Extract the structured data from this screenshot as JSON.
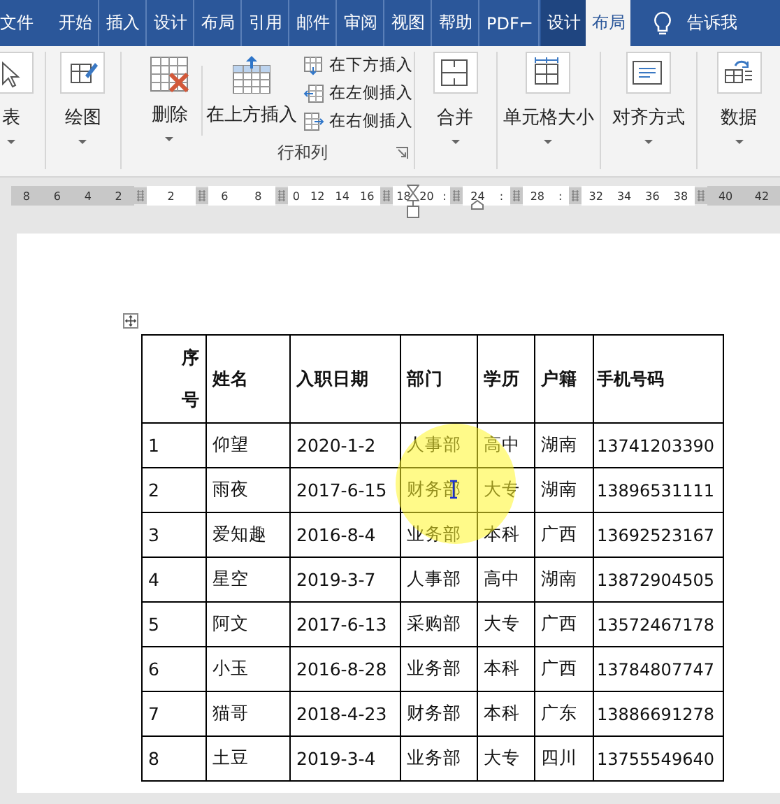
{
  "tabs": [
    {
      "label": "文件",
      "selected": false,
      "kind": "file"
    },
    {
      "label": "开始",
      "selected": false,
      "kind": "normal"
    },
    {
      "label": "插入",
      "selected": false,
      "kind": "normal"
    },
    {
      "label": "设计",
      "selected": false,
      "kind": "normal"
    },
    {
      "label": "布局",
      "selected": false,
      "kind": "normal"
    },
    {
      "label": "引用",
      "selected": false,
      "kind": "normal"
    },
    {
      "label": "邮件",
      "selected": false,
      "kind": "normal"
    },
    {
      "label": "审阅",
      "selected": false,
      "kind": "normal"
    },
    {
      "label": "视图",
      "selected": false,
      "kind": "normal"
    },
    {
      "label": "帮助",
      "selected": false,
      "kind": "normal"
    },
    {
      "label": "PDF⌐",
      "selected": false,
      "kind": "normal"
    },
    {
      "label": "设计",
      "selected": false,
      "kind": "context"
    },
    {
      "label": "布局",
      "selected": true,
      "kind": "context"
    }
  ],
  "tell_me": "告诉我",
  "ribbon": {
    "buttons": [
      {
        "label": "表",
        "kind": "select"
      },
      {
        "label": "绘图",
        "kind": "draw"
      },
      {
        "label": "删除",
        "kind": "delete"
      },
      {
        "label": "在上方插入",
        "kind": "above"
      }
    ],
    "small_buttons": [
      {
        "label": "在下方插入",
        "kind": "below"
      },
      {
        "label": "在左侧插入",
        "kind": "left"
      },
      {
        "label": "在右侧插入",
        "kind": "right"
      }
    ],
    "group_label": "行和列",
    "more_buttons": [
      {
        "label": "合并",
        "kind": "merge"
      },
      {
        "label": "单元格大小",
        "kind": "size"
      },
      {
        "label": "对齐方式",
        "kind": "align"
      },
      {
        "label": "数据",
        "kind": "data"
      }
    ]
  },
  "ruler": [
    {
      "labels": [
        "8",
        "6",
        "4",
        "2"
      ],
      "shaded": true
    },
    {
      "labels": [
        "2"
      ],
      "shaded": false
    },
    {
      "labels": [
        "6",
        "8"
      ],
      "shaded": false
    },
    {
      "labels": [
        "0",
        "12",
        "14",
        "16"
      ],
      "shaded": false
    },
    {
      "labels": [
        "18",
        "20",
        ":"
      ],
      "shaded": false
    },
    {
      "labels": [
        "24",
        ":"
      ],
      "shaded": false
    },
    {
      "labels": [
        "28",
        ":"
      ],
      "shaded": false
    },
    {
      "labels": [
        "32",
        "34",
        "36",
        "38"
      ],
      "shaded": false
    },
    {
      "labels": [
        "40",
        "42"
      ],
      "shaded": true
    }
  ],
  "table": {
    "columns": [
      "序号",
      "姓名",
      "入职日期",
      "部门",
      "学历",
      "户籍",
      "手机号码"
    ],
    "rows": [
      [
        "1",
        "仰望",
        "2020-1-2",
        "人事部",
        "高中",
        "湖南",
        "13741203390"
      ],
      [
        "2",
        "雨夜",
        "2017-6-15",
        "财务部",
        "大专",
        "湖南",
        "13896531111"
      ],
      [
        "3",
        "爱知趣",
        "2016-8-4",
        "业务部",
        "本科",
        "广西",
        "13692523167"
      ],
      [
        "4",
        "星空",
        "2019-3-7",
        "人事部",
        "高中",
        "湖南",
        "13872904505"
      ],
      [
        "5",
        "阿文",
        "2017-6-13",
        "采购部",
        "大专",
        "广西",
        "13572467178"
      ],
      [
        "6",
        "小玉",
        "2016-8-28",
        "业务部",
        "本科",
        "广西",
        "13784807747"
      ],
      [
        "7",
        "猫哥",
        "2018-4-23",
        "财务部",
        "本科",
        "广东",
        "13886691278"
      ],
      [
        "8",
        "土豆",
        "2019-3-4",
        "业务部",
        "大专",
        "四川",
        "13755549640"
      ]
    ]
  }
}
